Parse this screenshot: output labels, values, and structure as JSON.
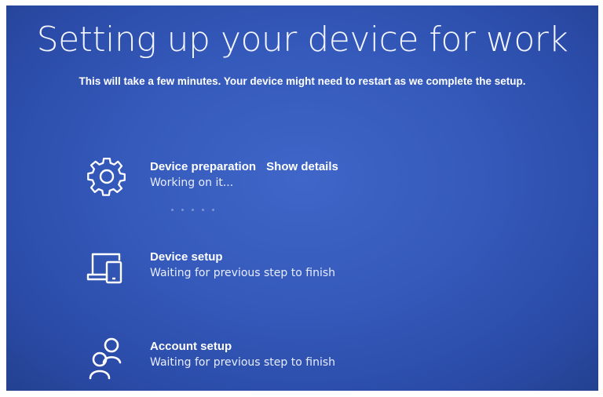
{
  "page": {
    "title": "Setting up your device for work",
    "subtitle": "This will take a few minutes. Your device might need to restart as we complete the setup."
  },
  "steps": [
    {
      "name": "Device preparation",
      "link": "Show details",
      "status": "Working on it...",
      "icon": "gear-icon"
    },
    {
      "name": "Device setup",
      "status": "Waiting for previous step to finish",
      "icon": "devices-icon"
    },
    {
      "name": "Account setup",
      "status": "Waiting for previous step to finish",
      "icon": "people-icon"
    }
  ],
  "colors": {
    "background": "#3459ba",
    "text": "#ffffff"
  }
}
